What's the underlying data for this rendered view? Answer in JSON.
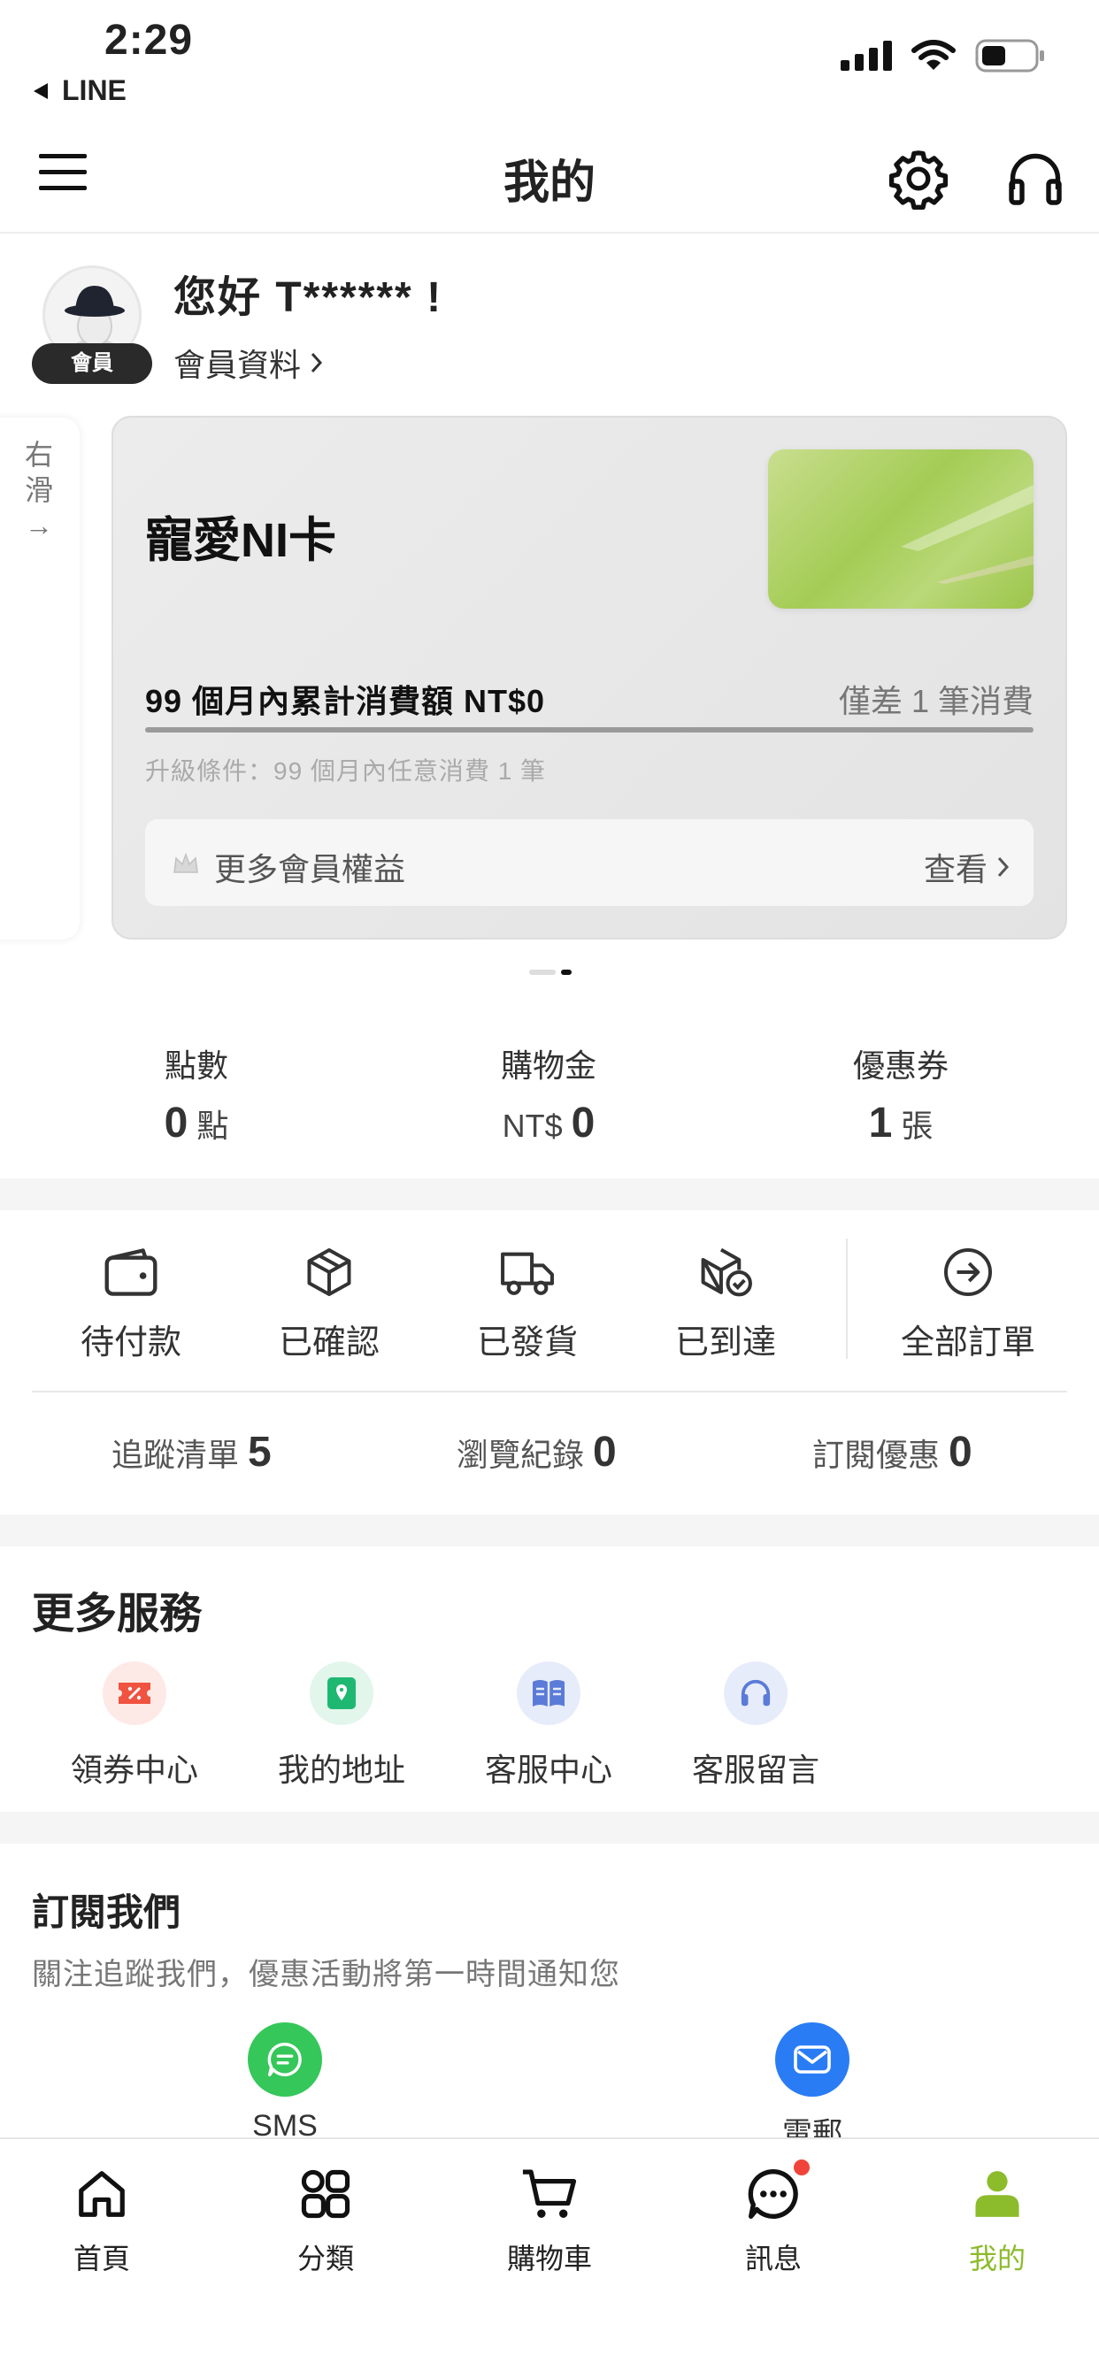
{
  "status_bar": {
    "time": "2:29",
    "back_app": "LINE"
  },
  "header": {
    "title": "我的"
  },
  "profile": {
    "greeting": "您好 T****** !",
    "member_badge": "會員",
    "member_info_link": "會員資料"
  },
  "carousel": {
    "swipe_hint": "右滑→",
    "card": {
      "title": "寵愛NI卡",
      "spend_label": "99 個月內累計消費額 NT$0",
      "remaining": "僅差 1 筆消費",
      "progress": 0,
      "upgrade_condition": "升級條件：99 個月內任意消費 1 筆",
      "benefits_label": "更多會員權益",
      "benefits_view": "查看"
    },
    "page_count": 2,
    "active_page": 2
  },
  "stats": [
    {
      "label": "點數",
      "value": "0",
      "unit_after": "點",
      "unit_before": ""
    },
    {
      "label": "購物金",
      "value": "0",
      "unit_before": "NT$",
      "unit_after": ""
    },
    {
      "label": "優惠券",
      "value": "1",
      "unit_after": "張",
      "unit_before": ""
    }
  ],
  "orders": [
    {
      "label": "待付款",
      "icon": "wallet-icon"
    },
    {
      "label": "已確認",
      "icon": "box-icon"
    },
    {
      "label": "已發貨",
      "icon": "truck-icon"
    },
    {
      "label": "已到達",
      "icon": "box-check-icon"
    },
    {
      "label": "全部訂單",
      "icon": "arrow-circle-icon"
    }
  ],
  "tracking": [
    {
      "label": "追蹤清單",
      "count": "5"
    },
    {
      "label": "瀏覽紀錄",
      "count": "0"
    },
    {
      "label": "訂閱優惠",
      "count": "0"
    }
  ],
  "services": {
    "title": "更多服務",
    "items": [
      {
        "label": "領券中心",
        "icon": "coupon-icon",
        "color": "#f0533f"
      },
      {
        "label": "我的地址",
        "icon": "address-icon",
        "color": "#1fb872"
      },
      {
        "label": "客服中心",
        "icon": "book-icon",
        "color": "#5b7bd8"
      },
      {
        "label": "客服留言",
        "icon": "headset-icon",
        "color": "#5b7bd8"
      }
    ]
  },
  "subscribe": {
    "title": "訂閱我們",
    "description": "關注追蹤我們，優惠活動將第一時間通知您",
    "items": [
      {
        "label": "SMS",
        "icon": "sms-icon",
        "color": "#35c759"
      },
      {
        "label": "電郵",
        "icon": "email-icon",
        "color": "#2a7cf5"
      }
    ]
  },
  "tabbar": {
    "items": [
      {
        "label": "首頁",
        "icon": "home-icon"
      },
      {
        "label": "分類",
        "icon": "category-icon"
      },
      {
        "label": "購物車",
        "icon": "cart-icon"
      },
      {
        "label": "訊息",
        "icon": "chat-icon",
        "badge": true
      },
      {
        "label": "我的",
        "icon": "profile-icon",
        "active": true
      }
    ],
    "active_color": "#8cbb2c"
  }
}
